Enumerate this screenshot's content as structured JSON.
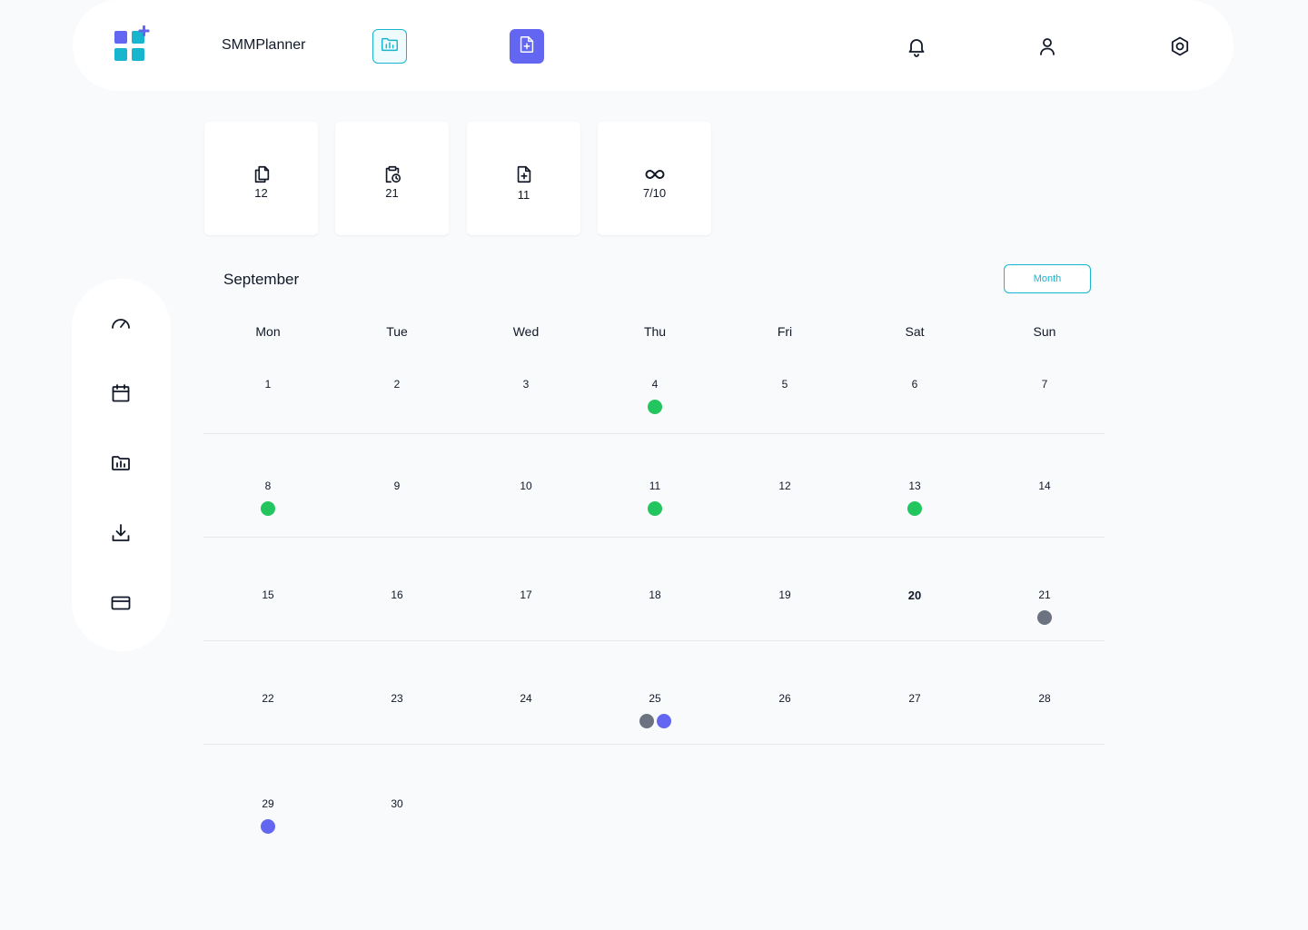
{
  "header": {
    "app_name": "SMMPlanner",
    "icons": [
      "logo-icon",
      "folder-chart-icon",
      "add-document-icon",
      "bell-icon",
      "user-icon",
      "settings-icon"
    ]
  },
  "sidebar": {
    "items": [
      {
        "icon": "dashboard-gauge-icon"
      },
      {
        "icon": "calendar-icon"
      },
      {
        "icon": "folder-chart-icon"
      },
      {
        "icon": "download-icon"
      },
      {
        "icon": "credit-card-icon"
      }
    ]
  },
  "stats": [
    {
      "icon": "copy-documents-icon",
      "value": "12"
    },
    {
      "icon": "clipboard-clock-icon",
      "value": "21"
    },
    {
      "icon": "add-document-icon",
      "value": "11"
    },
    {
      "icon": "infinity-icon",
      "value": "7/10"
    }
  ],
  "calendar": {
    "month": "September",
    "view_label": "Month",
    "weekdays": [
      "Mon",
      "Tue",
      "Wed",
      "Thu",
      "Fri",
      "Sat",
      "Sun"
    ],
    "today": "20",
    "colors": {
      "green": "#22c55e",
      "gray": "#6b7280",
      "indigo": "#6366f1"
    },
    "weeks": [
      [
        {
          "d": "1"
        },
        {
          "d": "2"
        },
        {
          "d": "3"
        },
        {
          "d": "4",
          "dots": [
            "green"
          ]
        },
        {
          "d": "5"
        },
        {
          "d": "6"
        },
        {
          "d": "7"
        }
      ],
      [
        {
          "d": "8",
          "dots": [
            "green"
          ]
        },
        {
          "d": "9"
        },
        {
          "d": "10"
        },
        {
          "d": "11",
          "dots": [
            "green"
          ]
        },
        {
          "d": "12"
        },
        {
          "d": "13",
          "dots": [
            "green"
          ]
        },
        {
          "d": "14"
        }
      ],
      [
        {
          "d": "15"
        },
        {
          "d": "16"
        },
        {
          "d": "17"
        },
        {
          "d": "18"
        },
        {
          "d": "19"
        },
        {
          "d": "20"
        },
        {
          "d": "21",
          "dots": [
            "gray"
          ]
        }
      ],
      [
        {
          "d": "22"
        },
        {
          "d": "23"
        },
        {
          "d": "24"
        },
        {
          "d": "25",
          "dots": [
            "gray",
            "indigo"
          ]
        },
        {
          "d": "26"
        },
        {
          "d": "27"
        },
        {
          "d": "28"
        }
      ],
      [
        {
          "d": "29",
          "dots": [
            "indigo"
          ]
        },
        {
          "d": "30"
        }
      ]
    ]
  }
}
